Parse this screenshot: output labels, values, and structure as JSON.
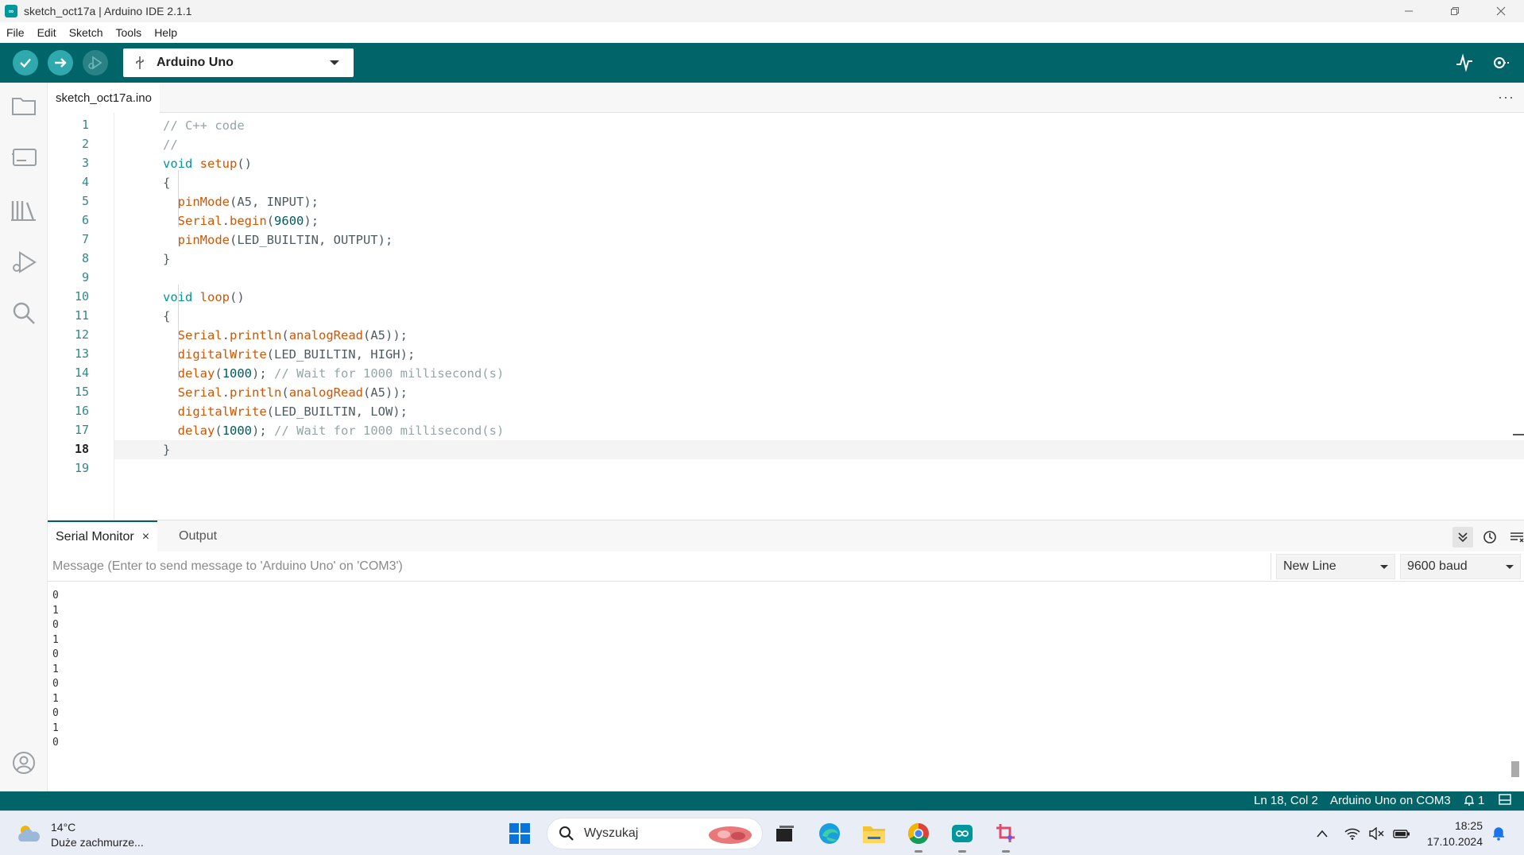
{
  "window": {
    "title": "sketch_oct17a | Arduino IDE 2.1.1",
    "app_icon": "arduino-logo-icon",
    "controls": [
      "minimize-icon",
      "restore-icon",
      "close-icon"
    ]
  },
  "menu": [
    "File",
    "Edit",
    "Sketch",
    "Tools",
    "Help"
  ],
  "toolbar": {
    "verify": "verify-check-icon",
    "upload": "upload-arrow-icon",
    "debug": "debug-icon",
    "board": "Arduino Uno",
    "board_icon": "usb-icon",
    "serial_plotter": "serial-plotter-icon",
    "serial_monitor": "serial-monitor-icon"
  },
  "sidebar": [
    "sketchbook-folder-icon",
    "boards-manager-icon",
    "library-manager-icon",
    "debug-run-icon",
    "search-icon",
    "account-icon"
  ],
  "editor": {
    "file_tab": "sketch_oct17a.ino",
    "more": "···",
    "active_line": 18,
    "lines": [
      {
        "n": "1",
        "tokens": [
          {
            "t": "// C++ code",
            "c": "comment"
          }
        ]
      },
      {
        "n": "2",
        "tokens": [
          {
            "t": "//",
            "c": "comment"
          }
        ]
      },
      {
        "n": "3",
        "tokens": [
          {
            "t": "void",
            "c": "type"
          },
          {
            "t": " ",
            "c": "default"
          },
          {
            "t": "setup",
            "c": "func"
          },
          {
            "t": "()",
            "c": "default"
          }
        ]
      },
      {
        "n": "4",
        "tokens": [
          {
            "t": "{",
            "c": "default"
          }
        ]
      },
      {
        "n": "5",
        "tokens": [
          {
            "t": "  ",
            "c": "default"
          },
          {
            "t": "pinMode",
            "c": "func"
          },
          {
            "t": "(A5, INPUT);",
            "c": "default"
          }
        ]
      },
      {
        "n": "6",
        "tokens": [
          {
            "t": "  ",
            "c": "default"
          },
          {
            "t": "Serial",
            "c": "func"
          },
          {
            "t": ".",
            "c": "default"
          },
          {
            "t": "begin",
            "c": "func"
          },
          {
            "t": "(",
            "c": "default"
          },
          {
            "t": "9600",
            "c": "num"
          },
          {
            "t": ");",
            "c": "default"
          }
        ]
      },
      {
        "n": "7",
        "tokens": [
          {
            "t": "  ",
            "c": "default"
          },
          {
            "t": "pinMode",
            "c": "func"
          },
          {
            "t": "(LED_BUILTIN, OUTPUT);",
            "c": "default"
          }
        ]
      },
      {
        "n": "8",
        "tokens": [
          {
            "t": "}",
            "c": "default"
          }
        ]
      },
      {
        "n": "9",
        "tokens": []
      },
      {
        "n": "10",
        "tokens": [
          {
            "t": "void",
            "c": "type"
          },
          {
            "t": " ",
            "c": "default"
          },
          {
            "t": "loop",
            "c": "func"
          },
          {
            "t": "()",
            "c": "default"
          }
        ]
      },
      {
        "n": "11",
        "tokens": [
          {
            "t": "{",
            "c": "default"
          }
        ]
      },
      {
        "n": "12",
        "tokens": [
          {
            "t": "  ",
            "c": "default"
          },
          {
            "t": "Serial",
            "c": "func"
          },
          {
            "t": ".",
            "c": "default"
          },
          {
            "t": "println",
            "c": "func"
          },
          {
            "t": "(",
            "c": "default"
          },
          {
            "t": "analogRead",
            "c": "func"
          },
          {
            "t": "(A5));",
            "c": "default"
          }
        ]
      },
      {
        "n": "13",
        "tokens": [
          {
            "t": "  ",
            "c": "default"
          },
          {
            "t": "digitalWrite",
            "c": "func"
          },
          {
            "t": "(LED_BUILTIN, HIGH);",
            "c": "default"
          }
        ]
      },
      {
        "n": "14",
        "tokens": [
          {
            "t": "  ",
            "c": "default"
          },
          {
            "t": "delay",
            "c": "func"
          },
          {
            "t": "(",
            "c": "default"
          },
          {
            "t": "1000",
            "c": "num"
          },
          {
            "t": "); ",
            "c": "default"
          },
          {
            "t": "// Wait for 1000 millisecond(s)",
            "c": "comment"
          }
        ]
      },
      {
        "n": "15",
        "tokens": [
          {
            "t": "  ",
            "c": "default"
          },
          {
            "t": "Serial",
            "c": "func"
          },
          {
            "t": ".",
            "c": "default"
          },
          {
            "t": "println",
            "c": "func"
          },
          {
            "t": "(",
            "c": "default"
          },
          {
            "t": "analogRead",
            "c": "func"
          },
          {
            "t": "(A5));",
            "c": "default"
          }
        ]
      },
      {
        "n": "16",
        "tokens": [
          {
            "t": "  ",
            "c": "default"
          },
          {
            "t": "digitalWrite",
            "c": "func"
          },
          {
            "t": "(LED_BUILTIN, LOW);",
            "c": "default"
          }
        ]
      },
      {
        "n": "17",
        "tokens": [
          {
            "t": "  ",
            "c": "default"
          },
          {
            "t": "delay",
            "c": "func"
          },
          {
            "t": "(",
            "c": "default"
          },
          {
            "t": "1000",
            "c": "num"
          },
          {
            "t": "); ",
            "c": "default"
          },
          {
            "t": "// Wait for 1000 millisecond(s)",
            "c": "comment"
          }
        ]
      },
      {
        "n": "18",
        "tokens": [
          {
            "t": "}",
            "c": "default"
          }
        ]
      },
      {
        "n": "19",
        "tokens": []
      }
    ]
  },
  "panel": {
    "tabs": [
      {
        "label": "Serial Monitor",
        "active": true,
        "closable": true
      },
      {
        "label": "Output",
        "active": false,
        "closable": false
      }
    ],
    "close_icon": "×",
    "actions": [
      "autoscroll-icon",
      "timestamp-clock-icon",
      "clear-output-icon"
    ],
    "message_placeholder": "Message (Enter to send message to 'Arduino Uno' on 'COM3')",
    "line_ending": "New Line",
    "baud": "9600 baud",
    "output_lines": [
      "0",
      "1",
      "0",
      "1",
      "0",
      "1",
      "0",
      "1",
      "0",
      "1",
      "0"
    ]
  },
  "status": {
    "position": "Ln 18, Col 2",
    "board_port": "Arduino Uno on COM3",
    "notifications": "1",
    "notification_icon": "notification-bell-icon",
    "layout_icon": "toggle-panel-icon"
  },
  "taskbar": {
    "weather_temp": "14°C",
    "weather_desc": "Duże zachmurze...",
    "search_placeholder": "Wyszukaj",
    "apps": [
      "windows-start-icon",
      "search-icon",
      "search-highlight-image",
      "task-view-icon",
      "edge-icon",
      "file-explorer-icon",
      "chrome-icon",
      "arduino-ide-icon",
      "snipping-tool-icon"
    ],
    "tray": [
      "chevron-up-icon",
      "wifi-icon",
      "speaker-muted-icon",
      "battery-icon"
    ],
    "time": "18:25",
    "date": "17.10.2024"
  },
  "colors": {
    "toolbar": "#006468",
    "button": "#2fa9ad",
    "function": "#d35400",
    "type": "#00979c",
    "comment": "#95a5a6"
  }
}
